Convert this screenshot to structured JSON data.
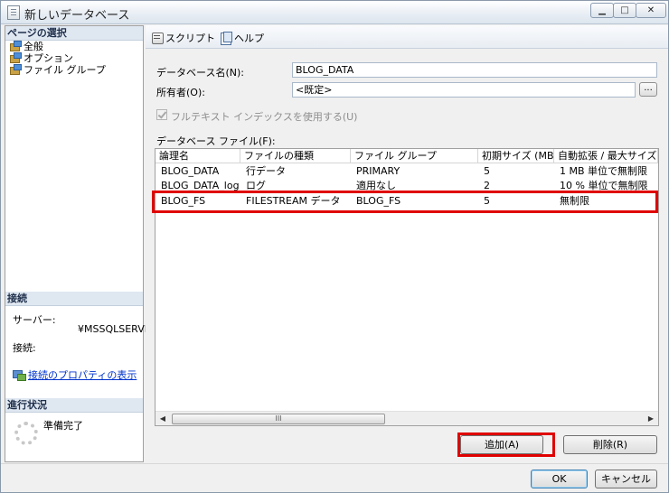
{
  "window": {
    "title": "新しいデータベース"
  },
  "left": {
    "page_select_header": "ページの選択",
    "nav_items": [
      {
        "label": "全般"
      },
      {
        "label": "オプション"
      },
      {
        "label": "ファイル グループ"
      }
    ],
    "connection_header": "接続",
    "server_label": "サーバー:",
    "server_value": "¥MSSQLSERVE",
    "connection_label": "接続:",
    "connection_properties_link": "接続のプロパティの表示",
    "progress_header": "進行状況",
    "progress_status": "準備完了"
  },
  "toolbar": {
    "script_label": "スクリプト",
    "help_label": "ヘルプ"
  },
  "form": {
    "db_name_label": "データベース名(N):",
    "db_name_value": "BLOG_DATA",
    "owner_label": "所有者(O):",
    "owner_value": "<既定>",
    "browse_label": "...",
    "fulltext_label": "フルテキスト インデックスを使用する(U)",
    "fulltext_checked": true,
    "db_files_label": "データベース ファイル(F):"
  },
  "files_table": {
    "columns": [
      "論理名",
      "ファイルの種類",
      "ファイル グループ",
      "初期サイズ (MB)",
      "自動拡張 / 最大サイズ"
    ],
    "rows": [
      {
        "logical_name": "BLOG_DATA",
        "file_type": "行データ",
        "filegroup": "PRIMARY",
        "initial_size": "5",
        "autogrowth": "1 MB 単位で無制限"
      },
      {
        "logical_name": "BLOG_DATA_log",
        "file_type": "ログ",
        "filegroup": "適用なし",
        "initial_size": "2",
        "autogrowth": "10 % 単位で無制限"
      },
      {
        "logical_name": "BLOG_FS",
        "file_type": "FILESTREAM データ",
        "filegroup": "BLOG_FS",
        "initial_size": "5",
        "autogrowth": "無制限"
      }
    ],
    "scroll_grip": "III"
  },
  "buttons": {
    "add": "追加(A)",
    "remove": "削除(R)",
    "ok": "OK",
    "cancel": "キャンセル"
  },
  "colors": {
    "highlight": "#e00000",
    "link": "#0033cc"
  }
}
